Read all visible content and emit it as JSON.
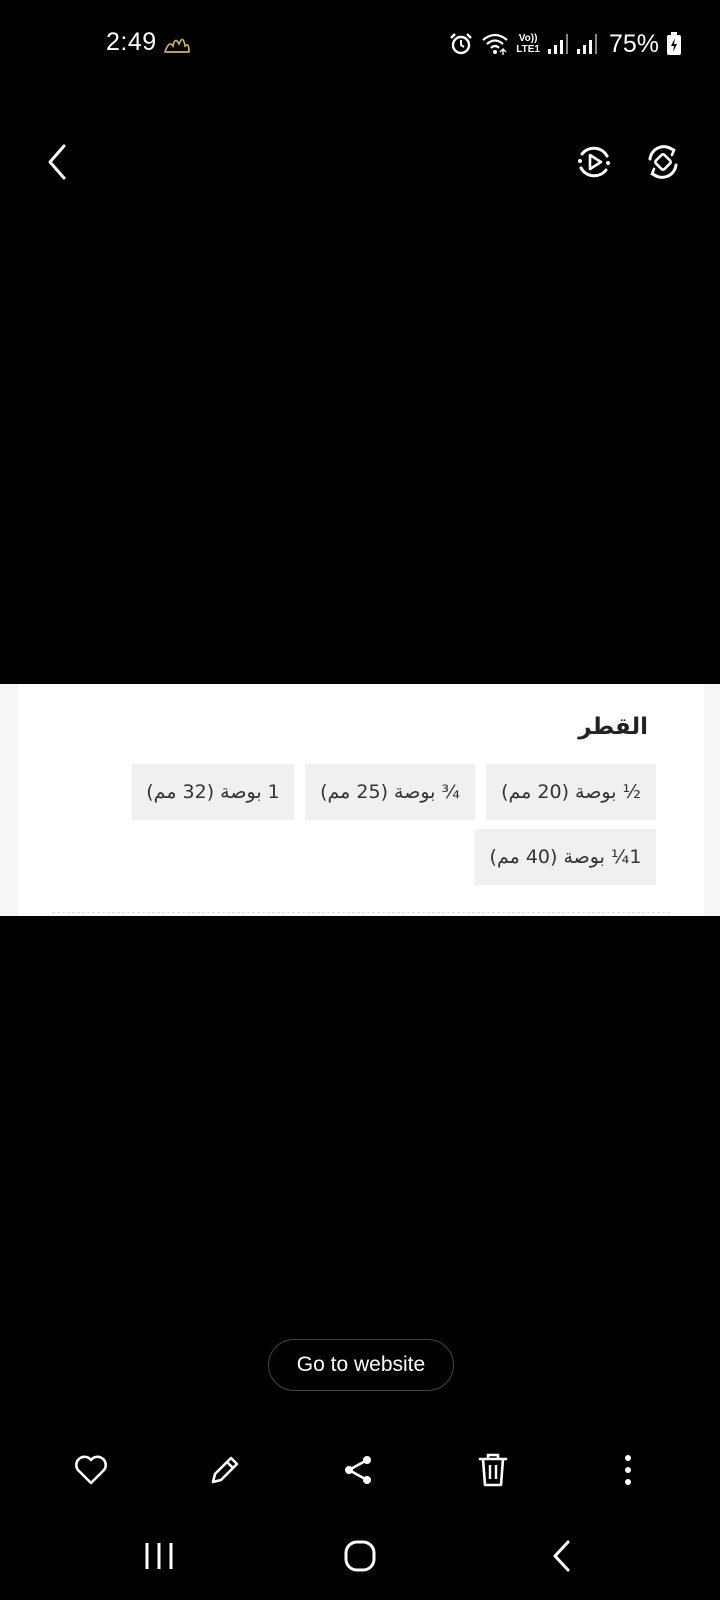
{
  "status_bar": {
    "time": "2:49",
    "network_label_top": "Vo))",
    "network_label_bottom": "LTE1",
    "battery": "75%",
    "icons": [
      "emblem-icon",
      "alarm-icon",
      "wifi-icon",
      "volte-icon",
      "signal-icon",
      "signal-icon",
      "battery-icon"
    ]
  },
  "top_bar": {
    "icons": [
      "back-icon",
      "motion-photo-icon",
      "rotate-icon"
    ]
  },
  "image": {
    "title": "القطر",
    "options": [
      "½ بوصة (20 مم)",
      "¾ بوصة (25 مم)",
      "1 بوصة (32 مم)",
      "1¼ بوصة (40 مم)"
    ]
  },
  "website_button": "Go to website",
  "actions": {
    "icons": [
      "heart-icon",
      "pencil-icon",
      "share-icon",
      "trash-icon",
      "more-icon"
    ]
  },
  "navigation": {
    "icons": [
      "recents-icon",
      "home-icon",
      "nav-back-icon"
    ]
  },
  "colors": {
    "background": "#000000",
    "card": "#ffffff",
    "chip": "#f0f0f0"
  }
}
